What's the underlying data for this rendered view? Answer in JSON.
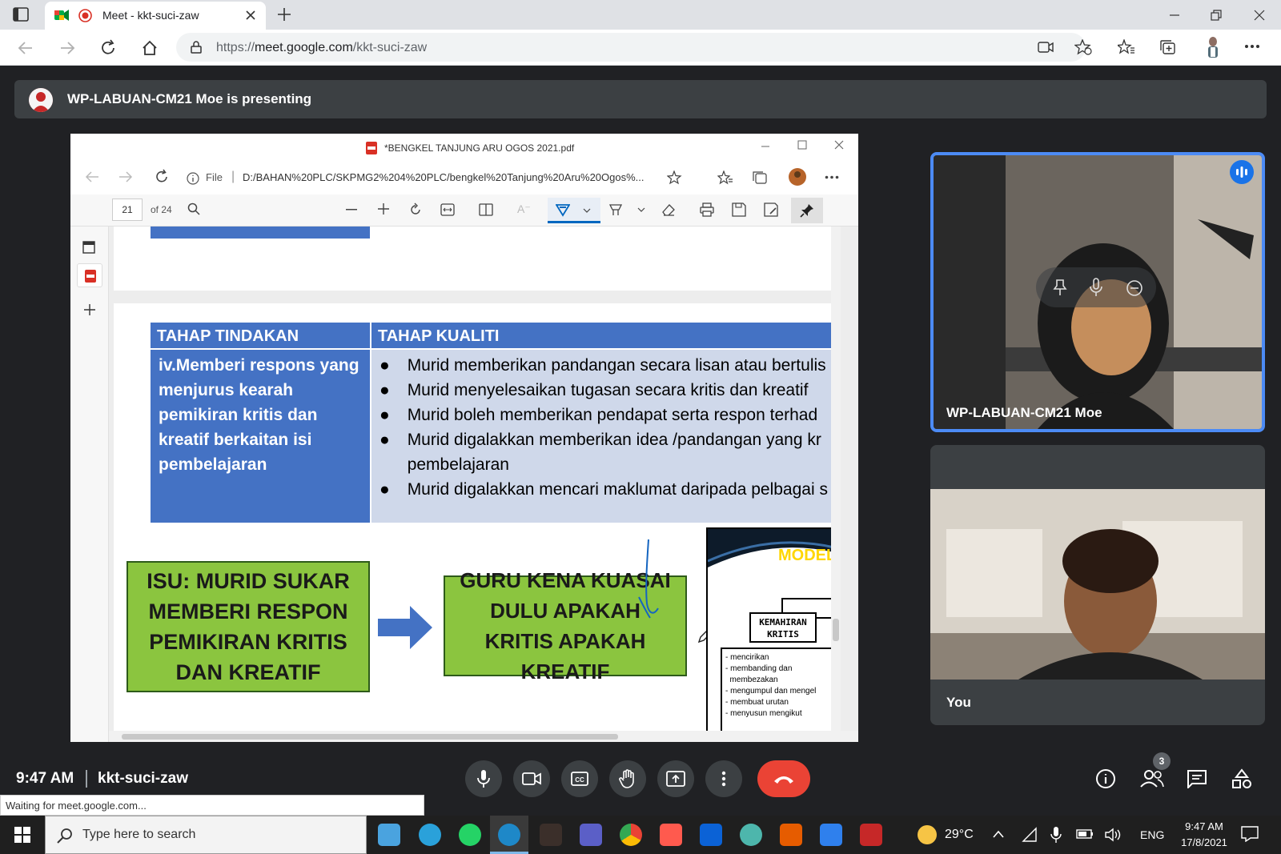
{
  "browser": {
    "tab_title": "Meet - kkt-suci-zaw",
    "url_prefix": "https://",
    "url_host": "meet.google.com",
    "url_path": "/kkt-suci-zaw"
  },
  "meet": {
    "presenting_text": "WP-LABUAN-CM21 Moe is presenting",
    "time": "9:47 AM",
    "meeting_code": "kkt-suci-zaw",
    "participants_count": "3",
    "tile1_name": "WP-LABUAN-CM21 Moe",
    "tile2_name": "You",
    "status_text": "Waiting for meet.google.com..."
  },
  "shared_screen": {
    "pdf_title": "*BENGKEL TANJUNG ARU OGOS 2021.pdf",
    "file_label": "File",
    "file_path": "D:/BAHAN%20PLC/SKPMG2%204%20PLC/bengkel%20Tanjung%20Aru%20Ogos%...",
    "page_current": "21",
    "page_total": "of 24",
    "table": {
      "header_left": "TAHAP TINDAKAN",
      "header_right": "TAHAP KUALITI",
      "left_text": "iv.Memberi respons yang menjurus kearah pemikiran kritis dan kreatif berkaitan isi pembelajaran",
      "bullets": [
        "Murid memberikan pandangan secara lisan atau bertulis",
        "Murid menyelesaikan tugasan secara kritis dan kreatif",
        "Murid boleh memberikan pendapat serta respon terhad",
        "Murid digalakkan memberikan idea /pandangan yang kr",
        "Murid digalakkan mencari maklumat daripada pelbagai s"
      ],
      "bullet4_cont": "pembelajaran"
    },
    "issue_box": "ISU: MURID SUKAR MEMBERI RESPON PEMIKIRAN KRITIS DAN KREATIF",
    "guru_box": "GURU KENA KUASAI DULU APAKAH KRITIS APAKAH KREATIF",
    "model_label": "MODEL",
    "kemahiran_label": "KEMAHIRAN KRITIS",
    "kemahiran_list": [
      "- mencirikan",
      "- membanding dan",
      "  membezakan",
      "- mengumpul dan mengel",
      "- membuat urutan",
      "- menyusun mengikut"
    ]
  },
  "taskbar": {
    "search_placeholder": "Type here to search",
    "weather": "29°C",
    "lang": "ENG",
    "clock_time": "9:47 AM",
    "clock_date": "17/8/2021"
  },
  "colors": {
    "meet_bg": "#202124",
    "end_call": "#ea4335",
    "active_speaker": "#4c8bf5",
    "table_header": "#4472c4",
    "table_body": "#cfd8ea",
    "green_box": "#8bc53f"
  }
}
